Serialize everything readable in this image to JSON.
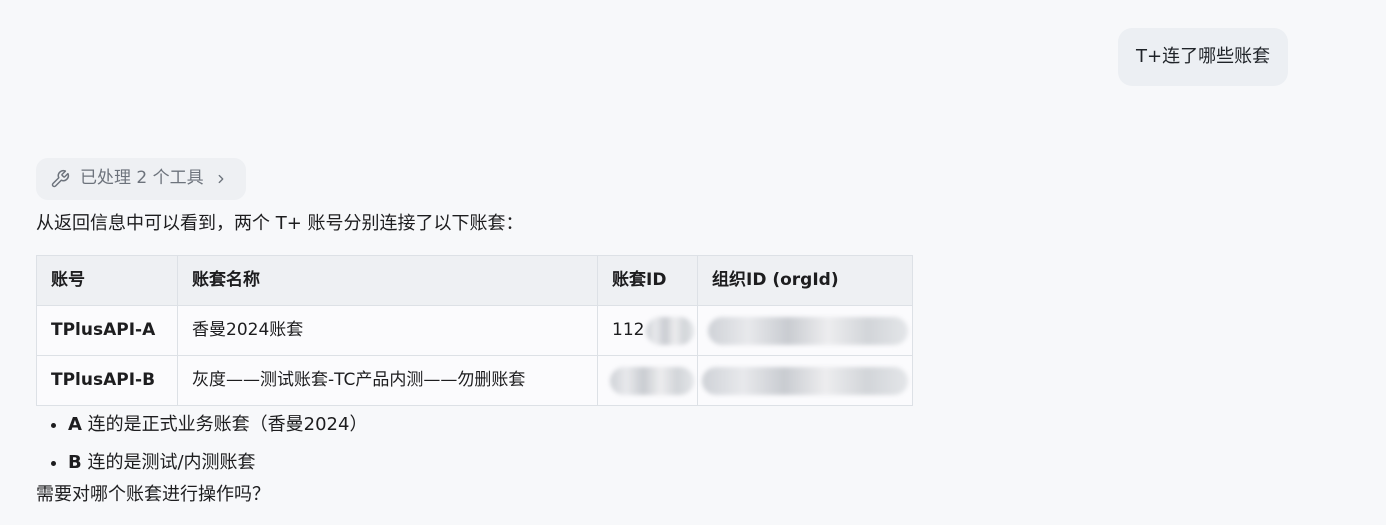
{
  "user_message": "T+连了哪些账套",
  "tool_chip": {
    "icon": "wrench-icon",
    "label": "已处理 2 个工具",
    "chevron_icon": "chevron-right-icon"
  },
  "intro": "从返回信息中可以看到，两个 T+ 账号分别连接了以下账套：",
  "table": {
    "headers": [
      "账号",
      "账套名称",
      "账套ID",
      "组织ID (orgId)"
    ],
    "rows": [
      {
        "account": "TPlusAPI-A",
        "ledger_name": "香曼2024账套",
        "ledger_id": "112",
        "org_id": ""
      },
      {
        "account": "TPlusAPI-B",
        "ledger_name": "灰度——测试账套-TC产品内测——勿删账套",
        "ledger_id": "",
        "org_id": ""
      }
    ]
  },
  "summary": [
    {
      "bold": "A",
      "text": " 连的是正式业务账套（香曼2024）"
    },
    {
      "bold": "B",
      "text": " 连的是测试/内测账套"
    }
  ],
  "closing": "需要对哪个账套进行操作吗？",
  "colors": {
    "background": "#f7f8fa",
    "bubble": "#eceff3",
    "chip": "#eef0f3",
    "table_header": "#eef0f3",
    "table_border": "#dde1e6",
    "muted_text": "#6d737c"
  }
}
